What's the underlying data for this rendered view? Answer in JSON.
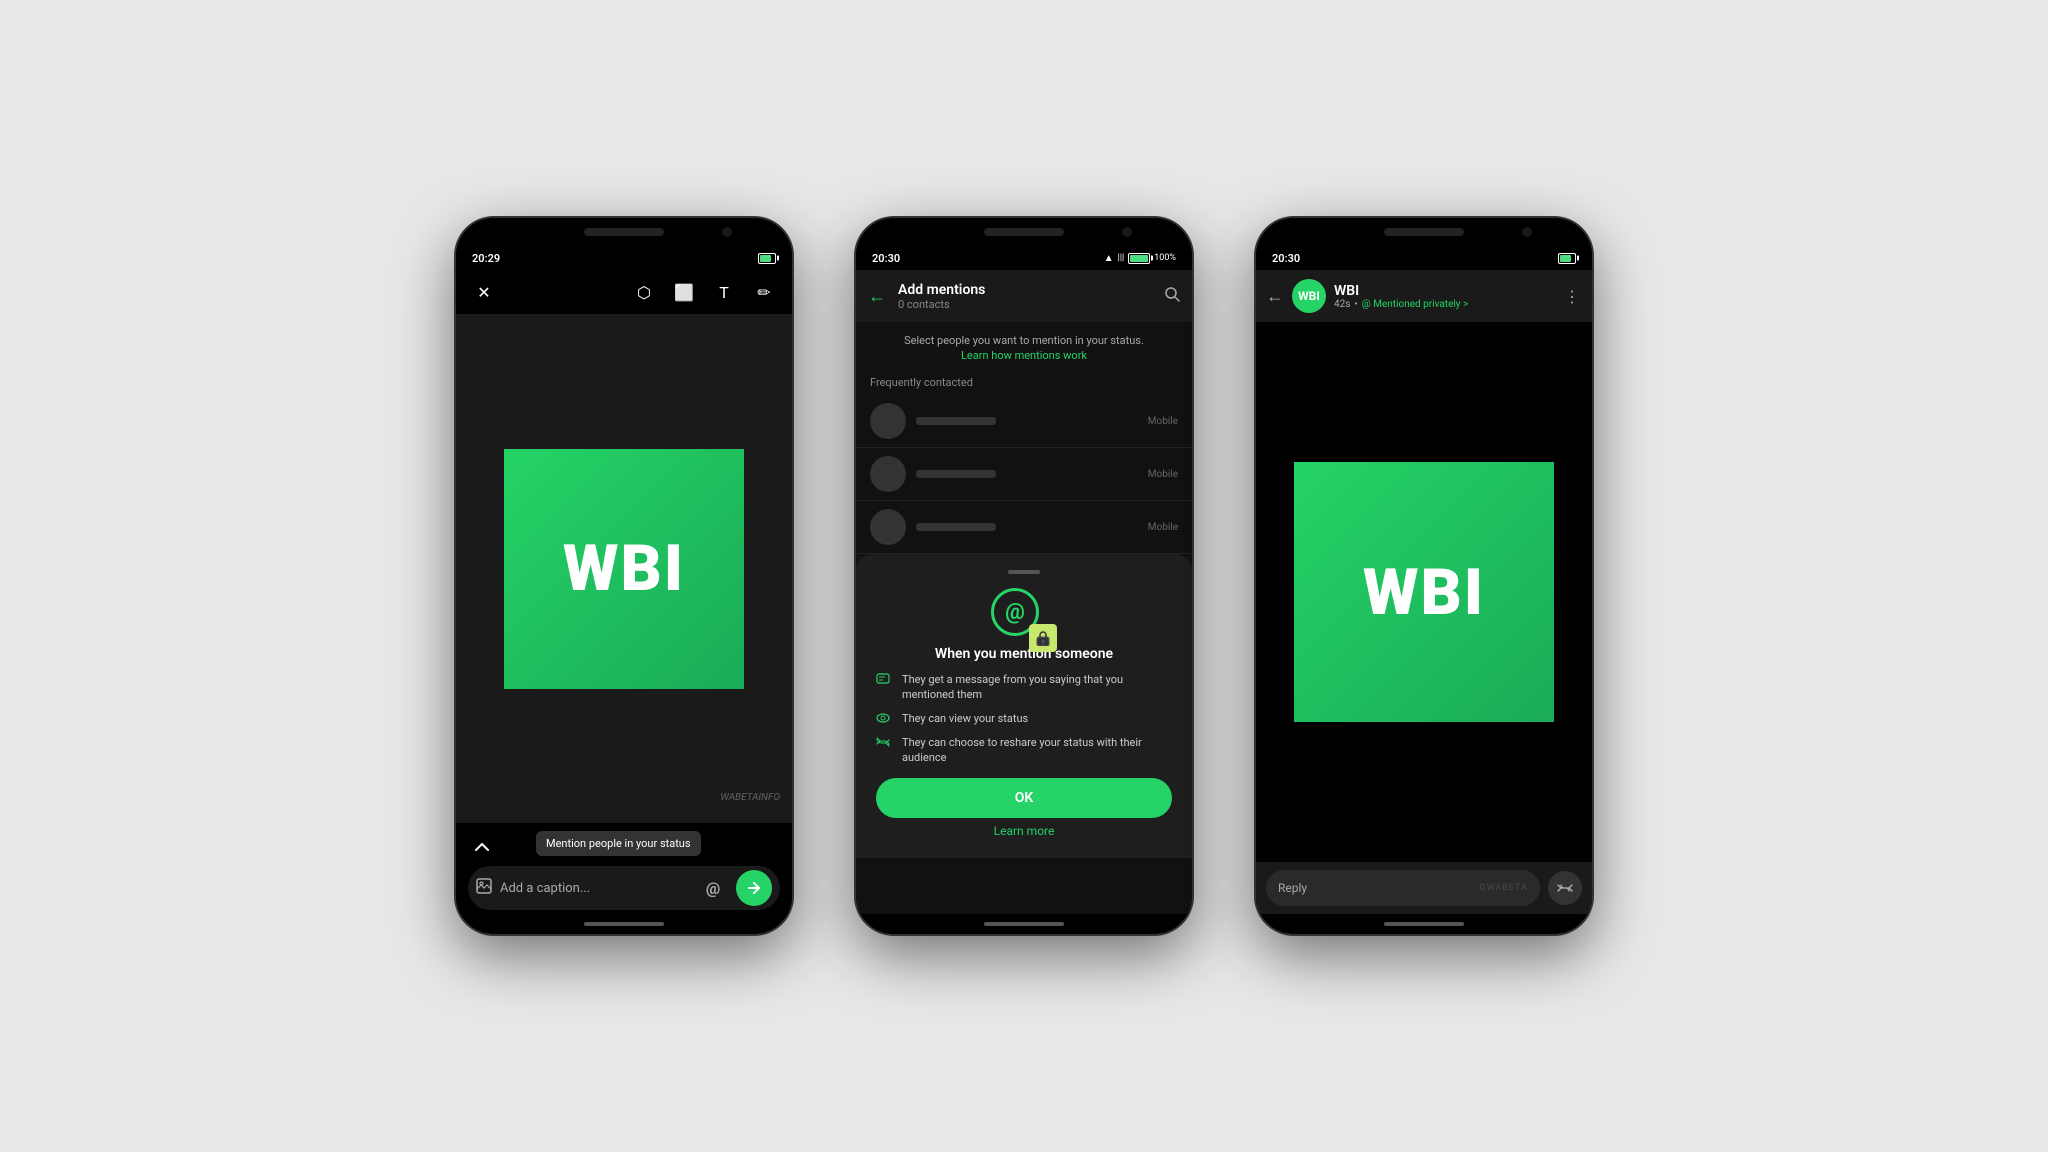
{
  "phone1": {
    "status_time": "20:29",
    "battery_level": "75",
    "toolbar": {
      "close_label": "✕",
      "sticker_label": "⬡",
      "crop_label": "⬜",
      "text_label": "T",
      "draw_label": "✏"
    },
    "caption_placeholder": "Add a caption...",
    "mention_tooltip": "Mention people in your status",
    "send_label": "➤",
    "at_label": "@"
  },
  "phone2": {
    "status_time": "20:30",
    "battery_level": "100%",
    "header": {
      "title": "Add mentions",
      "subtitle": "0 contacts",
      "back_label": "←"
    },
    "info_text": "Select people you want to mention in your status.",
    "learn_link": "Learn how mentions work",
    "section_label": "Frequently contacted",
    "contacts": [
      {
        "type": "Mobile"
      },
      {
        "type": "Mobile"
      },
      {
        "type": "Mobile"
      }
    ],
    "sheet": {
      "handle": "",
      "title": "When you mention someone",
      "items": [
        {
          "icon": "✉",
          "text": "They get a message from you saying that you mentioned them"
        },
        {
          "icon": "👁",
          "text": "They can view your status"
        },
        {
          "icon": "↺",
          "text": "They can choose to reshare your status with their audience"
        }
      ],
      "ok_label": "OK",
      "learn_more_label": "Learn more"
    }
  },
  "phone3": {
    "status_time": "20:30",
    "header": {
      "name": "WBI",
      "time": "42s",
      "mention_label": "@ Mentioned privately >",
      "back_label": "←"
    },
    "reply_placeholder": "Reply",
    "gwabeta": "GWABETA",
    "reshare_label": "⇄"
  },
  "wbi_logo": "WBI"
}
